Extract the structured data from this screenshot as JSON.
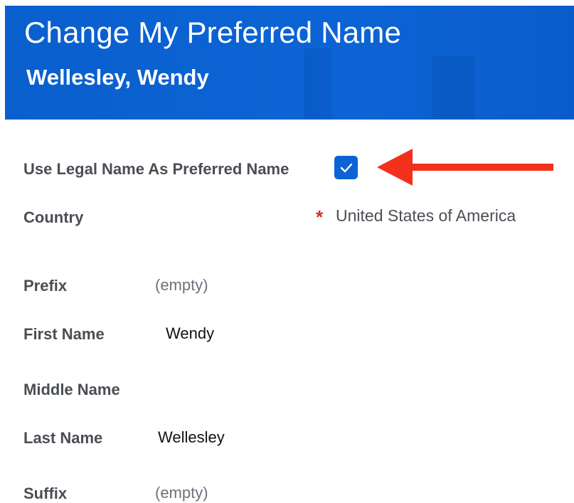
{
  "header": {
    "title": "Change My Preferred Name",
    "subtitle": "Wellesley, Wendy",
    "background_color": "#0c64d4"
  },
  "form": {
    "use_legal_name": {
      "label": "Use Legal Name As Preferred Name",
      "checked": true
    },
    "country": {
      "label": "Country",
      "required_marker": "*",
      "value": "United States of America"
    },
    "prefix": {
      "label": "Prefix",
      "value": "(empty)"
    },
    "first_name": {
      "label": "First Name",
      "value": "Wendy"
    },
    "middle_name": {
      "label": "Middle Name",
      "value": ""
    },
    "last_name": {
      "label": "Last Name",
      "value": "Wellesley"
    },
    "suffix": {
      "label": "Suffix",
      "value": "(empty)"
    }
  },
  "annotation": {
    "arrow_color": "#f2301b",
    "points_to": "use_legal_name checkbox"
  },
  "icons": {
    "checkbox_check": "check-icon",
    "annotation_arrow": "left-arrow-icon"
  }
}
